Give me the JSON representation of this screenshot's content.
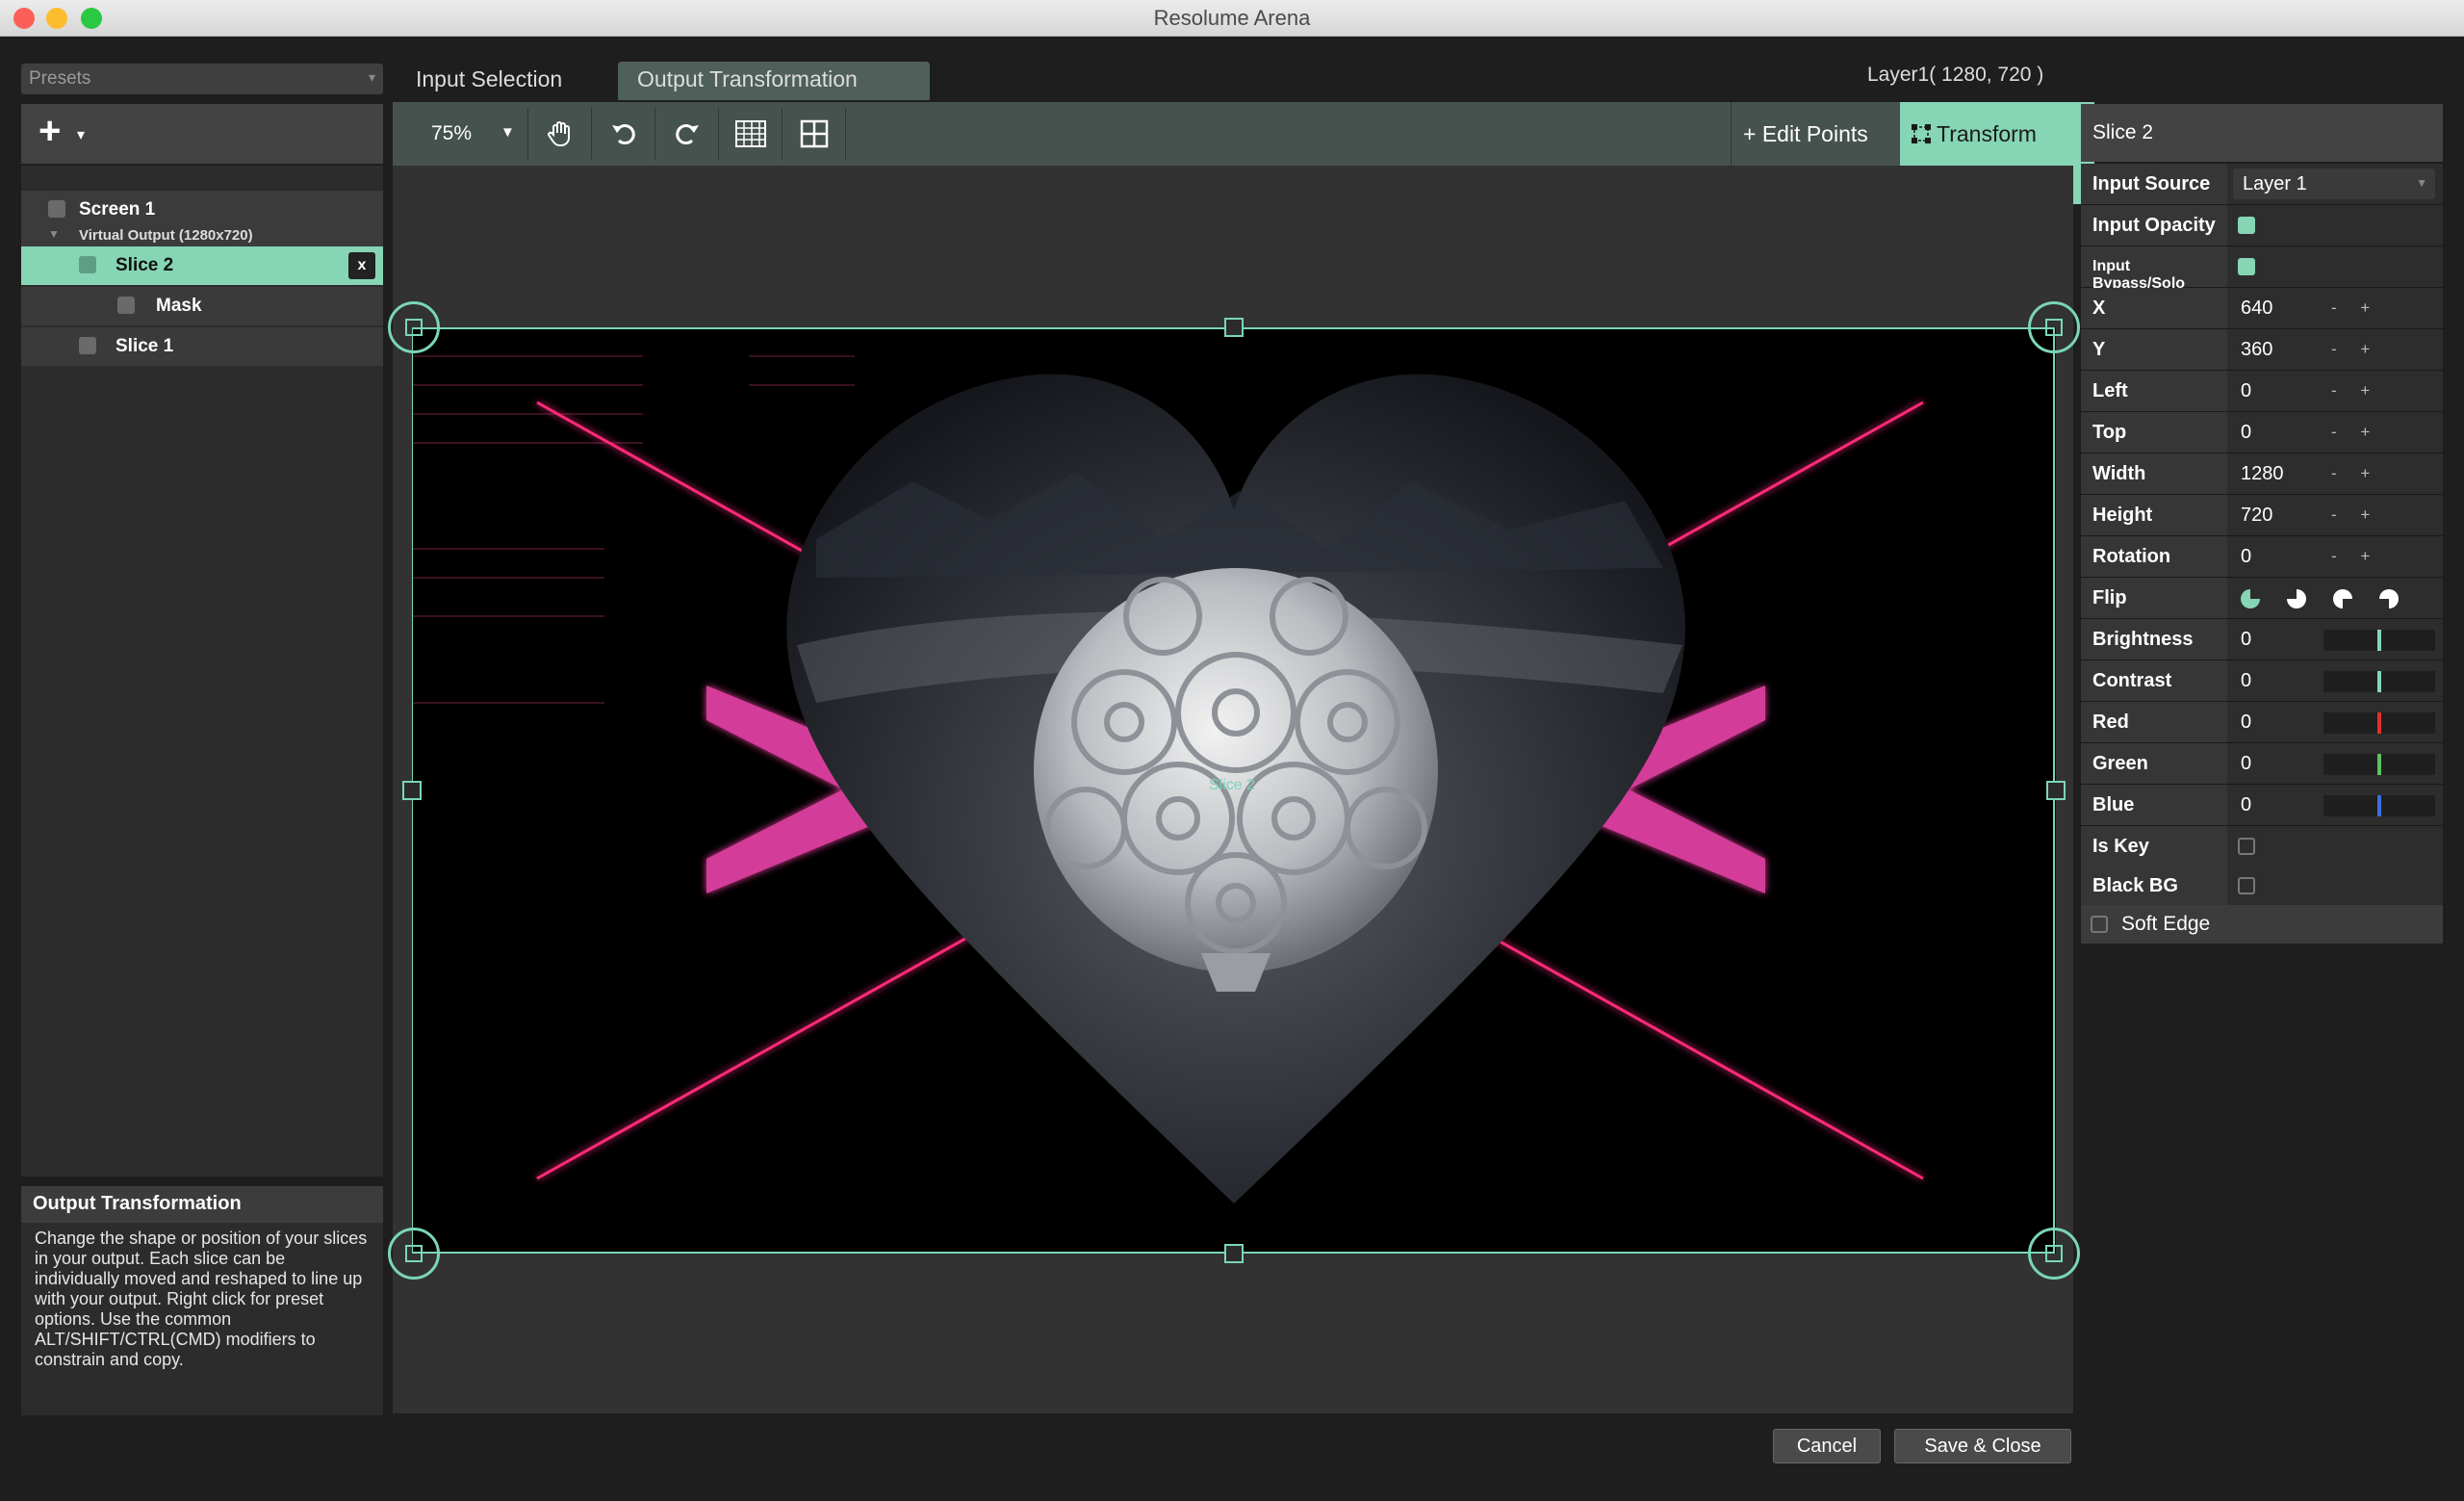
{
  "window": {
    "title": "Resolume Arena"
  },
  "left_panel": {
    "presets_label": "Presets",
    "tree": {
      "screen": "Screen 1",
      "virtual_output": "Virtual Output (1280x720)",
      "items": [
        {
          "label": "Slice 2",
          "selected": true,
          "remove_label": "x"
        },
        {
          "label": "Mask"
        },
        {
          "label": "Slice 1"
        }
      ]
    },
    "help": {
      "title": "Output Transformation",
      "text": "Change the shape or position of your slices in your output. Each slice can be individually moved and reshaped to line up with your output. Right click for preset options. Use the common ALT/SHIFT/CTRL(CMD) modifiers to constrain and copy."
    }
  },
  "tabs": {
    "input_selection": "Input Selection",
    "output_transformation": "Output Transformation",
    "active": "output_transformation"
  },
  "layer_info": "Layer1( 1280, 720 )",
  "toolbar": {
    "zoom": "75%",
    "icons": [
      "hand-icon",
      "undo-icon",
      "redo-icon",
      "grid-snap-icon",
      "grid-icon"
    ],
    "edit_points": "+ Edit Points",
    "transform": "Transform"
  },
  "canvas": {
    "slice_overlay_label": "Slice 2"
  },
  "right_panel": {
    "title": "Slice 2",
    "input_source": {
      "label": "Input Source",
      "value": "Layer 1"
    },
    "input_opacity": {
      "label": "Input Opacity",
      "checked": true
    },
    "input_bypass": {
      "label": "Input Bypass/Solo",
      "checked": true
    },
    "x": {
      "label": "X",
      "value": "640"
    },
    "y": {
      "label": "Y",
      "value": "360"
    },
    "left": {
      "label": "Left",
      "value": "0"
    },
    "top": {
      "label": "Top",
      "value": "0"
    },
    "width": {
      "label": "Width",
      "value": "1280"
    },
    "height": {
      "label": "Height",
      "value": "720"
    },
    "rotation": {
      "label": "Rotation",
      "value": "0"
    },
    "stepper": "- +",
    "flip": {
      "label": "Flip",
      "icons": [
        "flip-none-icon",
        "flip-horizontal-icon",
        "flip-vertical-icon",
        "flip-both-icon"
      ]
    },
    "brightness": {
      "label": "Brightness",
      "value": "0",
      "color": "#86d5b5"
    },
    "contrast": {
      "label": "Contrast",
      "value": "0",
      "color": "#86d5b5"
    },
    "red": {
      "label": "Red",
      "value": "0",
      "color": "#e03030"
    },
    "green": {
      "label": "Green",
      "value": "0",
      "color": "#5ec05e"
    },
    "blue": {
      "label": "Blue",
      "value": "0",
      "color": "#3d6fd8"
    },
    "is_key": {
      "label": "Is Key",
      "checked": false
    },
    "black_bg": {
      "label": "Black BG",
      "checked": false
    },
    "soft_edge": {
      "label": "Soft Edge",
      "checked": false
    }
  },
  "footer": {
    "cancel": "Cancel",
    "save_close": "Save & Close"
  },
  "colors": {
    "accent": "#86d5b5",
    "neon": "#ff3fa4"
  }
}
